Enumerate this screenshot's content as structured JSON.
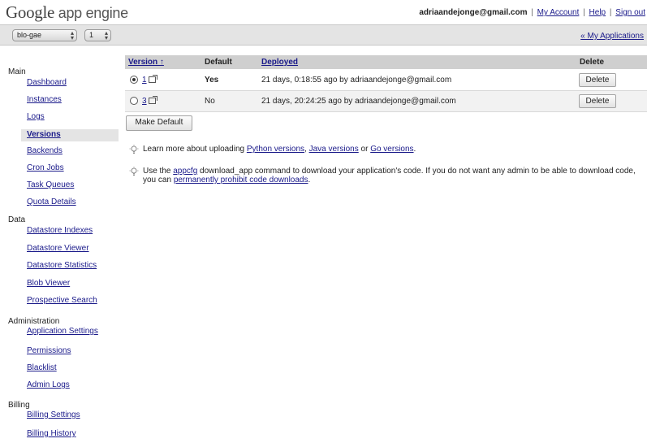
{
  "header": {
    "logo_google": "Google",
    "logo_rest": " app engine",
    "user_email": "adriaandejonge@gmail.com",
    "my_account": "My Account",
    "help": "Help",
    "sign_out": "Sign out",
    "separator": "|"
  },
  "appbar": {
    "app_select_value": "blo-gae",
    "version_select_value": "1",
    "my_applications": "« My Applications"
  },
  "sidebar": {
    "main_label": "Main",
    "main_items": [
      "Dashboard",
      "Instances",
      "Logs",
      "Versions",
      "Backends",
      "Cron Jobs",
      "Task Queues",
      "Quota Details"
    ],
    "selected": "Versions",
    "data_label": "Data",
    "data_items": [
      "Datastore Indexes",
      "Datastore Viewer",
      "Datastore Statistics",
      "Blob Viewer",
      "Prospective Search"
    ],
    "admin_label": "Administration",
    "admin_items": [
      "Application Settings",
      "Permissions",
      "Blacklist",
      "Admin Logs"
    ],
    "billing_label": "Billing",
    "billing_items": [
      "Billing Settings",
      "Billing History"
    ]
  },
  "table": {
    "col_version": "Version ↑",
    "col_default": "Default",
    "col_deployed": "Deployed",
    "col_delete": "Delete",
    "rows": [
      {
        "version": "1",
        "default": "Yes",
        "deployed": "21 days, 0:18:55 ago by adriaandejonge@gmail.com",
        "delete_label": "Delete",
        "selected": true
      },
      {
        "version": "3",
        "default": "No",
        "deployed": "21 days, 20:24:25 ago by adriaandejonge@gmail.com",
        "delete_label": "Delete",
        "selected": false
      }
    ],
    "make_default": "Make Default"
  },
  "tips": {
    "tip1_prefix": "Learn more about uploading ",
    "tip1_python": "Python versions",
    "tip1_comma": ", ",
    "tip1_java": "Java versions",
    "tip1_or": " or ",
    "tip1_go": "Go versions",
    "tip1_end": ".",
    "tip2_prefix": "Use the ",
    "tip2_appcfg": "appcfg",
    "tip2_middle": " download_app command to download your application's code. If you do not want any admin to be able to download code, you can ",
    "tip2_link": "permanently prohibit code downloads",
    "tip2_end": "."
  }
}
